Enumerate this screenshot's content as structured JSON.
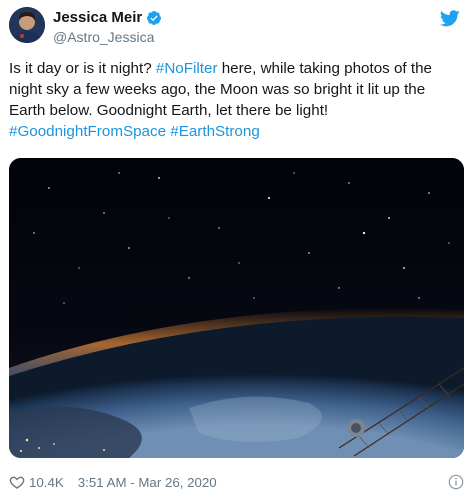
{
  "author": {
    "display_name": "Jessica Meir",
    "handle": "@Astro_Jessica",
    "verified": true,
    "avatar_icon": "avatar-photo"
  },
  "brand": {
    "icon": "twitter-bird-icon",
    "color": "#1da1f2"
  },
  "tweet": {
    "segments": [
      {
        "text": "Is it day or is it night? ",
        "type": "text"
      },
      {
        "text": "#NoFilter",
        "type": "hashtag"
      },
      {
        "text": " here, while taking photos of the night sky a few weeks ago, the Moon was so bright it lit up the Earth below. Goodnight Earth, let there be light!",
        "type": "text"
      },
      {
        "text": "#GoodnightFromSpace",
        "type": "hashtag"
      },
      {
        "text": " ",
        "type": "text"
      },
      {
        "text": "#EarthStrong",
        "type": "hashtag"
      }
    ]
  },
  "footer": {
    "like_icon": "heart-icon",
    "likes": "10.4K",
    "timestamp": "3:51 AM - Mar 26, 2020",
    "info_icon": "info-icon"
  },
  "colors": {
    "hashtag": "#1b95e0",
    "muted": "#657786",
    "text": "#14171a"
  }
}
